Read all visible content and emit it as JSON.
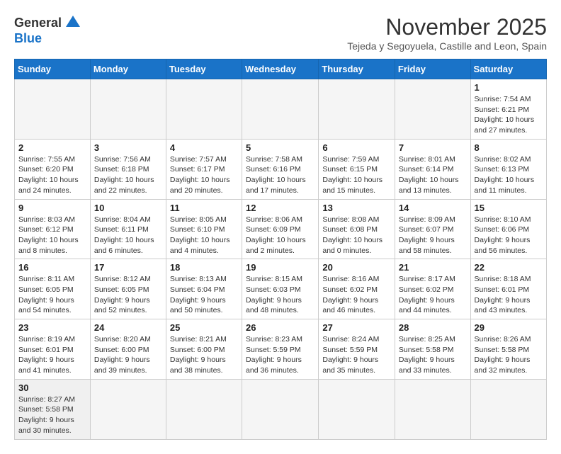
{
  "logo": {
    "general": "General",
    "blue": "Blue"
  },
  "header": {
    "month_year": "November 2025",
    "location": "Tejeda y Segoyuela, Castille and Leon, Spain"
  },
  "weekdays": [
    "Sunday",
    "Monday",
    "Tuesday",
    "Wednesday",
    "Thursday",
    "Friday",
    "Saturday"
  ],
  "weeks": [
    [
      {
        "day": "",
        "info": ""
      },
      {
        "day": "",
        "info": ""
      },
      {
        "day": "",
        "info": ""
      },
      {
        "day": "",
        "info": ""
      },
      {
        "day": "",
        "info": ""
      },
      {
        "day": "",
        "info": ""
      },
      {
        "day": "1",
        "info": "Sunrise: 7:54 AM\nSunset: 6:21 PM\nDaylight: 10 hours and 27 minutes."
      }
    ],
    [
      {
        "day": "2",
        "info": "Sunrise: 7:55 AM\nSunset: 6:20 PM\nDaylight: 10 hours and 24 minutes."
      },
      {
        "day": "3",
        "info": "Sunrise: 7:56 AM\nSunset: 6:18 PM\nDaylight: 10 hours and 22 minutes."
      },
      {
        "day": "4",
        "info": "Sunrise: 7:57 AM\nSunset: 6:17 PM\nDaylight: 10 hours and 20 minutes."
      },
      {
        "day": "5",
        "info": "Sunrise: 7:58 AM\nSunset: 6:16 PM\nDaylight: 10 hours and 17 minutes."
      },
      {
        "day": "6",
        "info": "Sunrise: 7:59 AM\nSunset: 6:15 PM\nDaylight: 10 hours and 15 minutes."
      },
      {
        "day": "7",
        "info": "Sunrise: 8:01 AM\nSunset: 6:14 PM\nDaylight: 10 hours and 13 minutes."
      },
      {
        "day": "8",
        "info": "Sunrise: 8:02 AM\nSunset: 6:13 PM\nDaylight: 10 hours and 11 minutes."
      }
    ],
    [
      {
        "day": "9",
        "info": "Sunrise: 8:03 AM\nSunset: 6:12 PM\nDaylight: 10 hours and 8 minutes."
      },
      {
        "day": "10",
        "info": "Sunrise: 8:04 AM\nSunset: 6:11 PM\nDaylight: 10 hours and 6 minutes."
      },
      {
        "day": "11",
        "info": "Sunrise: 8:05 AM\nSunset: 6:10 PM\nDaylight: 10 hours and 4 minutes."
      },
      {
        "day": "12",
        "info": "Sunrise: 8:06 AM\nSunset: 6:09 PM\nDaylight: 10 hours and 2 minutes."
      },
      {
        "day": "13",
        "info": "Sunrise: 8:08 AM\nSunset: 6:08 PM\nDaylight: 10 hours and 0 minutes."
      },
      {
        "day": "14",
        "info": "Sunrise: 8:09 AM\nSunset: 6:07 PM\nDaylight: 9 hours and 58 minutes."
      },
      {
        "day": "15",
        "info": "Sunrise: 8:10 AM\nSunset: 6:06 PM\nDaylight: 9 hours and 56 minutes."
      }
    ],
    [
      {
        "day": "16",
        "info": "Sunrise: 8:11 AM\nSunset: 6:05 PM\nDaylight: 9 hours and 54 minutes."
      },
      {
        "day": "17",
        "info": "Sunrise: 8:12 AM\nSunset: 6:05 PM\nDaylight: 9 hours and 52 minutes."
      },
      {
        "day": "18",
        "info": "Sunrise: 8:13 AM\nSunset: 6:04 PM\nDaylight: 9 hours and 50 minutes."
      },
      {
        "day": "19",
        "info": "Sunrise: 8:15 AM\nSunset: 6:03 PM\nDaylight: 9 hours and 48 minutes."
      },
      {
        "day": "20",
        "info": "Sunrise: 8:16 AM\nSunset: 6:02 PM\nDaylight: 9 hours and 46 minutes."
      },
      {
        "day": "21",
        "info": "Sunrise: 8:17 AM\nSunset: 6:02 PM\nDaylight: 9 hours and 44 minutes."
      },
      {
        "day": "22",
        "info": "Sunrise: 8:18 AM\nSunset: 6:01 PM\nDaylight: 9 hours and 43 minutes."
      }
    ],
    [
      {
        "day": "23",
        "info": "Sunrise: 8:19 AM\nSunset: 6:01 PM\nDaylight: 9 hours and 41 minutes."
      },
      {
        "day": "24",
        "info": "Sunrise: 8:20 AM\nSunset: 6:00 PM\nDaylight: 9 hours and 39 minutes."
      },
      {
        "day": "25",
        "info": "Sunrise: 8:21 AM\nSunset: 6:00 PM\nDaylight: 9 hours and 38 minutes."
      },
      {
        "day": "26",
        "info": "Sunrise: 8:23 AM\nSunset: 5:59 PM\nDaylight: 9 hours and 36 minutes."
      },
      {
        "day": "27",
        "info": "Sunrise: 8:24 AM\nSunset: 5:59 PM\nDaylight: 9 hours and 35 minutes."
      },
      {
        "day": "28",
        "info": "Sunrise: 8:25 AM\nSunset: 5:58 PM\nDaylight: 9 hours and 33 minutes."
      },
      {
        "day": "29",
        "info": "Sunrise: 8:26 AM\nSunset: 5:58 PM\nDaylight: 9 hours and 32 minutes."
      }
    ],
    [
      {
        "day": "30",
        "info": "Sunrise: 8:27 AM\nSunset: 5:58 PM\nDaylight: 9 hours and 30 minutes."
      },
      {
        "day": "",
        "info": ""
      },
      {
        "day": "",
        "info": ""
      },
      {
        "day": "",
        "info": ""
      },
      {
        "day": "",
        "info": ""
      },
      {
        "day": "",
        "info": ""
      },
      {
        "day": "",
        "info": ""
      }
    ]
  ]
}
